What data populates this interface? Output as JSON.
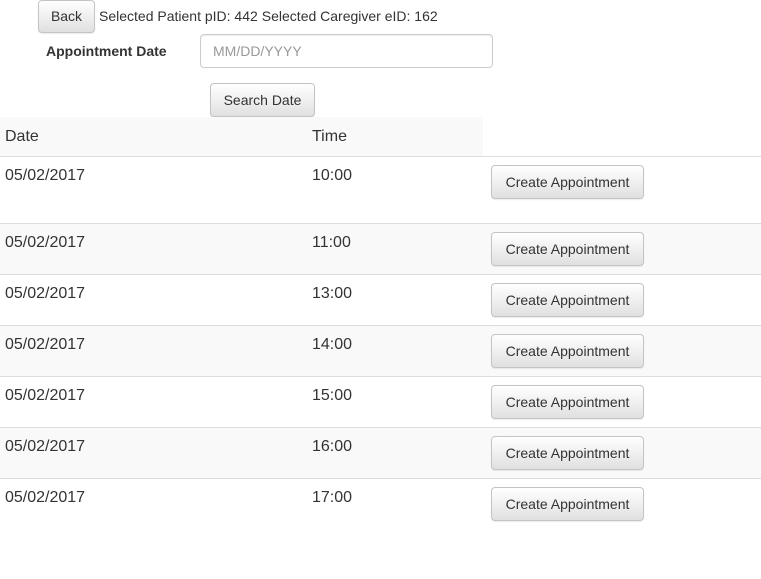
{
  "header": {
    "back_label": "Back",
    "patient_text": "Selected Patient pID: 442",
    "caregiver_text": "Selected Caregiver eID: 162"
  },
  "form": {
    "date_label": "Appointment Date",
    "date_placeholder": "MM/DD/YYYY",
    "date_value": "",
    "search_label": "Search Date"
  },
  "table": {
    "columns": [
      "Date",
      "Time"
    ],
    "rows": [
      {
        "date": "05/02/2017",
        "time": "10:00",
        "action": "Create Appointment"
      },
      {
        "date": "05/02/2017",
        "time": "11:00",
        "action": "Create Appointment"
      },
      {
        "date": "05/02/2017",
        "time": "13:00",
        "action": "Create Appointment"
      },
      {
        "date": "05/02/2017",
        "time": "14:00",
        "action": "Create Appointment"
      },
      {
        "date": "05/02/2017",
        "time": "15:00",
        "action": "Create Appointment"
      },
      {
        "date": "05/02/2017",
        "time": "16:00",
        "action": "Create Appointment"
      },
      {
        "date": "05/02/2017",
        "time": "17:00",
        "action": "Create Appointment"
      }
    ]
  }
}
